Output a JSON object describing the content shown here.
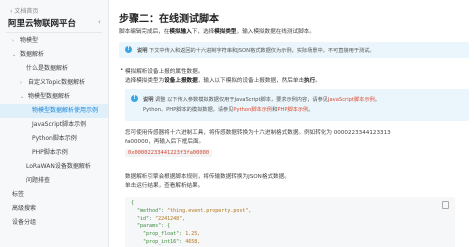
{
  "sidebar": {
    "top_link": "文档首页",
    "title": "阿里云物联网平台",
    "collapse_icon": "chevron-left-icon",
    "items": [
      {
        "label": "物模型",
        "chevron": "›",
        "indent": 12
      },
      {
        "label": "数据解析",
        "chevron": "⌄",
        "indent": 12
      },
      {
        "label": "什么是数据解析",
        "chevron": "",
        "indent": 26
      },
      {
        "label": "自定义Topic数据解析",
        "chevron": "›",
        "indent": 20
      },
      {
        "label": "物模型数据解析",
        "chevron": "⌄",
        "indent": 20
      },
      {
        "label": "物模型数据解析使用示例",
        "chevron": "",
        "indent": 32,
        "active": true
      },
      {
        "label": "JavaScript脚本示例",
        "chevron": "",
        "indent": 32
      },
      {
        "label": "Python脚本示例",
        "chevron": "",
        "indent": 32
      },
      {
        "label": "PHP脚本示例",
        "chevron": "",
        "indent": 32
      },
      {
        "label": "LoRaWAN设备数据解析",
        "chevron": "",
        "indent": 26
      },
      {
        "label": "问题排查",
        "chevron": "",
        "indent": 26
      },
      {
        "label": "标签",
        "chevron": "",
        "indent": 12
      },
      {
        "label": "高级搜索",
        "chevron": "",
        "indent": 12
      },
      {
        "label": "设备分组",
        "chevron": "",
        "indent": 12
      }
    ]
  },
  "main": {
    "heading": "步骤二：在线测试脚本",
    "intro_pre": "脚本编辑完成后，在",
    "intro_bold1": "模拟输入",
    "intro_mid": "下，选择",
    "intro_bold2": "模拟类型",
    "intro_post": "，输入模拟数据在线测试脚本。",
    "note1_label": "说明",
    "note1_text": "下文中传入和返回的十六进制字符串和JSON格式数据仅为示例，实际场景中，不可直接用于测试。",
    "bullet1_line1": "模拟解析设备上报的属性数据。",
    "bullet1_line2_pre": "选择模拟类型为",
    "bullet1_line2_bold": "设备上报数据",
    "bullet1_line2_mid": "，输入以下模拟的设备上报数据，然后单击",
    "bullet1_line2_bold2": "执行",
    "bullet1_line2_post": "。",
    "note2_label": "说明",
    "note2_line1_pre": "调整 以下传入参数模拟数据仅用于JavaScript脚本，要求示例内容，请参见",
    "note2_line1_link": "JavaScript脚本示例",
    "note2_line1_post": "。",
    "note2_line2_pre": "Python、PHP脚本的模拟数据，请参见",
    "note2_line2_link1": "Python脚本示例",
    "note2_line2_mid": "和",
    "note2_line2_link2": "PHP脚本示例",
    "note2_line2_post": "。",
    "para1_line1": "您可使用传感器将十六进制工具，将传感数据转换为十六进制格式数据。例如转化为    0000223344123313",
    "para1_line2": "fa00000，再输入后下框后面。",
    "code_inline": "0x00002233441223f3fa00000",
    "para2_line1": "数据解析引擎会根据脚本规则，将传输数据转换为JSON格式数据。",
    "para2_line2": "单击运行结果，查看解析结果。"
  },
  "code_lines": [
    {
      "t": "{",
      "c": ""
    },
    {
      "t": "  \"method\": ",
      "c": "\"thing.event.property.post\","
    },
    {
      "t": "  \"id\": ",
      "c": "\"2241248\","
    },
    {
      "t": "  \"params\": {",
      "c": ""
    },
    {
      "t": "    \"prop_float\": ",
      "c": "1.25,"
    },
    {
      "t": "    \"prop_int16\": ",
      "c": "4658,"
    }
  ]
}
